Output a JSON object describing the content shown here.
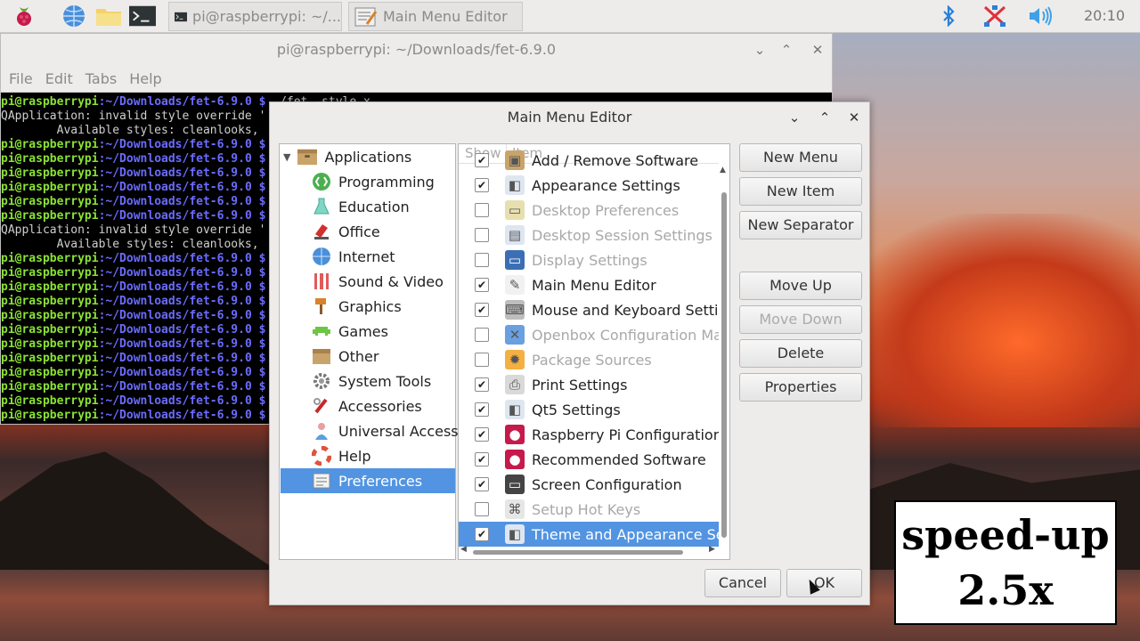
{
  "taskbar": {
    "tasks": [
      {
        "label": "pi@raspberrypi: ~/..."
      },
      {
        "label": "Main Menu Editor"
      }
    ],
    "clock": "20:10"
  },
  "terminal": {
    "title": "pi@raspberrypi: ~/Downloads/fet-6.9.0",
    "menu": [
      "File",
      "Edit",
      "Tabs",
      "Help"
    ],
    "prompt_user": "pi@raspberrypi",
    "prompt_path": ":~/Downloads/fet-6.9.0 $",
    "first_command": " ./fet -style x",
    "error_line": "QApplication: invalid style override '",
    "styles_line": "        Available styles: cleanlooks,",
    "lines": [
      "p",
      "e",
      "s",
      "p",
      "p",
      "p",
      "p",
      "p",
      "p",
      "e",
      "s",
      "p",
      "p",
      "p",
      "p",
      "p",
      "p",
      "p",
      "p",
      "p",
      "p",
      "p",
      "p"
    ]
  },
  "dialog": {
    "title": "Main Menu Editor",
    "tree": {
      "root": "Applications",
      "items": [
        "Programming",
        "Education",
        "Office",
        "Internet",
        "Sound & Video",
        "Graphics",
        "Games",
        "Other",
        "System Tools",
        "Accessories",
        "Universal Access",
        "Help",
        "Preferences"
      ],
      "selected": "Preferences"
    },
    "items_header": {
      "show": "Show",
      "item": "Item"
    },
    "items": [
      {
        "name": "Add / Remove Software",
        "checked": true,
        "enabled": true,
        "icon": "package-icon"
      },
      {
        "name": "Appearance Settings",
        "checked": true,
        "enabled": true,
        "icon": "appearance-icon"
      },
      {
        "name": "Desktop Preferences",
        "checked": false,
        "enabled": false,
        "icon": "desktop-icon"
      },
      {
        "name": "Desktop Session Settings",
        "checked": false,
        "enabled": false,
        "icon": "session-icon"
      },
      {
        "name": "Display Settings",
        "checked": false,
        "enabled": false,
        "icon": "display-icon"
      },
      {
        "name": "Main Menu Editor",
        "checked": true,
        "enabled": true,
        "icon": "menu-editor-icon"
      },
      {
        "name": "Mouse and Keyboard Settings",
        "checked": true,
        "enabled": true,
        "icon": "keyboard-icon"
      },
      {
        "name": "Openbox Configuration Manager",
        "checked": false,
        "enabled": false,
        "icon": "openbox-icon"
      },
      {
        "name": "Package Sources",
        "checked": false,
        "enabled": false,
        "icon": "sources-icon"
      },
      {
        "name": "Print Settings",
        "checked": true,
        "enabled": true,
        "icon": "printer-icon"
      },
      {
        "name": "Qt5 Settings",
        "checked": true,
        "enabled": true,
        "icon": "qt-icon"
      },
      {
        "name": "Raspberry Pi Configuration",
        "checked": true,
        "enabled": true,
        "icon": "raspberry-icon"
      },
      {
        "name": "Recommended Software",
        "checked": true,
        "enabled": true,
        "icon": "raspberry-icon"
      },
      {
        "name": "Screen Configuration",
        "checked": true,
        "enabled": true,
        "icon": "monitor-icon"
      },
      {
        "name": "Setup Hot Keys",
        "checked": false,
        "enabled": false,
        "icon": "hotkeys-icon"
      },
      {
        "name": "Theme and Appearance Settings",
        "checked": true,
        "enabled": true,
        "icon": "theme-icon"
      }
    ],
    "selected_item": "Theme and Appearance Settings",
    "buttons": {
      "new_menu": "New Menu",
      "new_item": "New Item",
      "new_separator": "New Separator",
      "move_up": "Move Up",
      "move_down": "Move Down",
      "delete": "Delete",
      "properties": "Properties",
      "cancel": "Cancel",
      "ok": "OK"
    }
  },
  "overlay": {
    "line1": "speed-up",
    "line2": "2.5x"
  },
  "colors": {
    "selection": "#5294e2",
    "prompt_user": "#8ae234",
    "prompt_path": "#6b6bff"
  }
}
